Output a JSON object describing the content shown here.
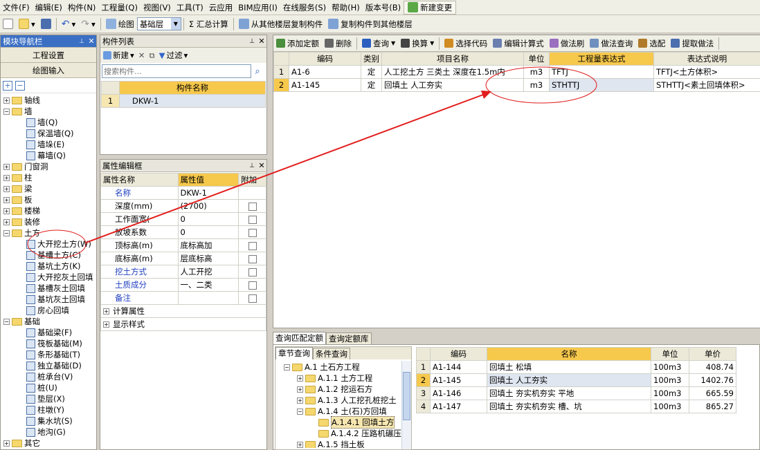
{
  "menu": [
    "文件(F)",
    "编辑(E)",
    "构件(N)",
    "工程量(Q)",
    "视图(V)",
    "工具(T)",
    "云应用",
    "BIM应用(I)",
    "在线服务(S)",
    "帮助(H)",
    "版本号(B)"
  ],
  "menu_new": "新建变更",
  "toolbar": {
    "draw": "绘图",
    "floor": "基础层",
    "sum": "Σ 汇总计算",
    "copy_from": "从其他楼层复制构件",
    "copy_to": "复制构件到其他楼层"
  },
  "nav": {
    "title": "模块导航栏",
    "btn1": "工程设置",
    "btn2": "绘图输入",
    "tree": [
      {
        "label": "轴线",
        "type": "folder",
        "level": 0,
        "sign": "+"
      },
      {
        "label": "墙",
        "type": "folder",
        "level": 0,
        "sign": "−"
      },
      {
        "label": "墙(Q)",
        "type": "item",
        "level": 1
      },
      {
        "label": "保温墙(Q)",
        "type": "item",
        "level": 1
      },
      {
        "label": "墙垛(E)",
        "type": "item",
        "level": 1
      },
      {
        "label": "幕墙(Q)",
        "type": "item",
        "level": 1
      },
      {
        "label": "门窗洞",
        "type": "folder",
        "level": 0,
        "sign": "+"
      },
      {
        "label": "柱",
        "type": "folder",
        "level": 0,
        "sign": "+"
      },
      {
        "label": "梁",
        "type": "folder",
        "level": 0,
        "sign": "+"
      },
      {
        "label": "板",
        "type": "folder",
        "level": 0,
        "sign": "+"
      },
      {
        "label": "楼梯",
        "type": "folder",
        "level": 0,
        "sign": "+"
      },
      {
        "label": "装修",
        "type": "folder",
        "level": 0,
        "sign": "+"
      },
      {
        "label": "土方",
        "type": "folder",
        "level": 0,
        "sign": "−"
      },
      {
        "label": "大开挖土方(W)",
        "type": "item",
        "level": 1
      },
      {
        "label": "基槽土方(C)",
        "type": "item",
        "level": 1
      },
      {
        "label": "基坑土方(K)",
        "type": "item",
        "level": 1
      },
      {
        "label": "大开挖灰土回填",
        "type": "item",
        "level": 1
      },
      {
        "label": "基槽灰土回填",
        "type": "item",
        "level": 1
      },
      {
        "label": "基坑灰土回填",
        "type": "item",
        "level": 1
      },
      {
        "label": "房心回填",
        "type": "item",
        "level": 1
      },
      {
        "label": "基础",
        "type": "folder",
        "level": 0,
        "sign": "−"
      },
      {
        "label": "基础梁(F)",
        "type": "item",
        "level": 1
      },
      {
        "label": "筏板基础(M)",
        "type": "item",
        "level": 1
      },
      {
        "label": "条形基础(T)",
        "type": "item",
        "level": 1
      },
      {
        "label": "独立基础(D)",
        "type": "item",
        "level": 1
      },
      {
        "label": "桩承台(V)",
        "type": "item",
        "level": 1
      },
      {
        "label": "桩(U)",
        "type": "item",
        "level": 1
      },
      {
        "label": "垫层(X)",
        "type": "item",
        "level": 1
      },
      {
        "label": "柱墩(Y)",
        "type": "item",
        "level": 1
      },
      {
        "label": "集水坑(S)",
        "type": "item",
        "level": 1
      },
      {
        "label": "地沟(G)",
        "type": "item",
        "level": 1
      },
      {
        "label": "其它",
        "type": "folder",
        "level": 0,
        "sign": "+"
      }
    ]
  },
  "component_list": {
    "title": "构件列表",
    "new": "新建",
    "filter": "过滤",
    "search_placeholder": "搜索构件...",
    "col": "构件名称",
    "rows": [
      {
        "no": "1",
        "name": "DKW-1"
      }
    ]
  },
  "props": {
    "title": "属性编辑框",
    "cols": [
      "属性名称",
      "属性值",
      "附加"
    ],
    "rows": [
      {
        "name": "名称",
        "value": "DKW-1",
        "blue": true,
        "cb": false
      },
      {
        "name": "深度(mm)",
        "value": "(2700)",
        "blue": false,
        "cb": true
      },
      {
        "name": "工作面宽(",
        "value": "0",
        "blue": false,
        "cb": true
      },
      {
        "name": "放坡系数",
        "value": "0",
        "blue": false,
        "cb": true
      },
      {
        "name": "顶标高(m)",
        "value": "底标高加",
        "blue": false,
        "cb": true
      },
      {
        "name": "底标高(m)",
        "value": "层底标高",
        "blue": false,
        "cb": true
      },
      {
        "name": "挖土方式",
        "value": "人工开挖",
        "blue": true,
        "cb": true
      },
      {
        "name": "土质成分",
        "value": "一、二类",
        "blue": true,
        "cb": true
      },
      {
        "name": "备注",
        "value": "",
        "blue": true,
        "cb": true
      }
    ],
    "groups": [
      "计算属性",
      "显示样式"
    ]
  },
  "quota_toolbar": [
    "添加定额",
    "删除",
    "查询",
    "换算",
    "选择代码",
    "编辑计算式",
    "做法刷",
    "做法查询",
    "选配",
    "提取做法"
  ],
  "quota_table": {
    "cols": [
      "编码",
      "类别",
      "项目名称",
      "单位",
      "工程量表达式",
      "表达式说明"
    ],
    "rows": [
      {
        "no": "1",
        "code": "A1-6",
        "cat": "定",
        "name": "人工挖土方 三类土 深度在1.5m内",
        "unit": "m3",
        "expr": "TFTJ",
        "desc": "TFTJ<土方体积>"
      },
      {
        "no": "2",
        "code": "A1-145",
        "cat": "定",
        "name": "回填土 人工夯实",
        "unit": "m3",
        "expr": "STHTTJ",
        "desc": "STHTTJ<素土回填体积>"
      }
    ]
  },
  "bottom": {
    "tabs": [
      "查询匹配定额",
      "查询定额库"
    ],
    "subtabs": [
      "章节查询",
      "条件查询"
    ],
    "tree": [
      {
        "label": "A.1 土石方工程",
        "level": 0,
        "sign": "−"
      },
      {
        "label": "A.1.1 土方工程",
        "level": 1,
        "sign": "+"
      },
      {
        "label": "A.1.2 挖运石方",
        "level": 1,
        "sign": "+"
      },
      {
        "label": "A.1.3 人工挖孔桩挖土",
        "level": 1,
        "sign": "+"
      },
      {
        "label": "A.1.4 土(石)方回填",
        "level": 1,
        "sign": "−"
      },
      {
        "label": "A.1.4.1 回填土方",
        "level": 2,
        "sign": ""
      },
      {
        "label": "A.1.4.2 压路机碾压",
        "level": 2,
        "sign": ""
      },
      {
        "label": "A.1.5 挡土板",
        "level": 1,
        "sign": "+"
      }
    ],
    "cols": [
      "编码",
      "名称",
      "单位",
      "单价"
    ],
    "rows": [
      {
        "no": "1",
        "code": "A1-144",
        "name": "回填土 松填",
        "unit": "100m3",
        "price": "408.74"
      },
      {
        "no": "2",
        "code": "A1-145",
        "name": "回填土 人工夯实",
        "unit": "100m3",
        "price": "1402.76"
      },
      {
        "no": "3",
        "code": "A1-146",
        "name": "回填土 夯实机夯实 平地",
        "unit": "100m3",
        "price": "665.59"
      },
      {
        "no": "4",
        "code": "A1-147",
        "name": "回填土 夯实机夯实 槽、坑",
        "unit": "100m3",
        "price": "865.27"
      }
    ]
  },
  "colors": {
    "highlight": "#f6c84c",
    "annotation": "#e21d1d"
  }
}
